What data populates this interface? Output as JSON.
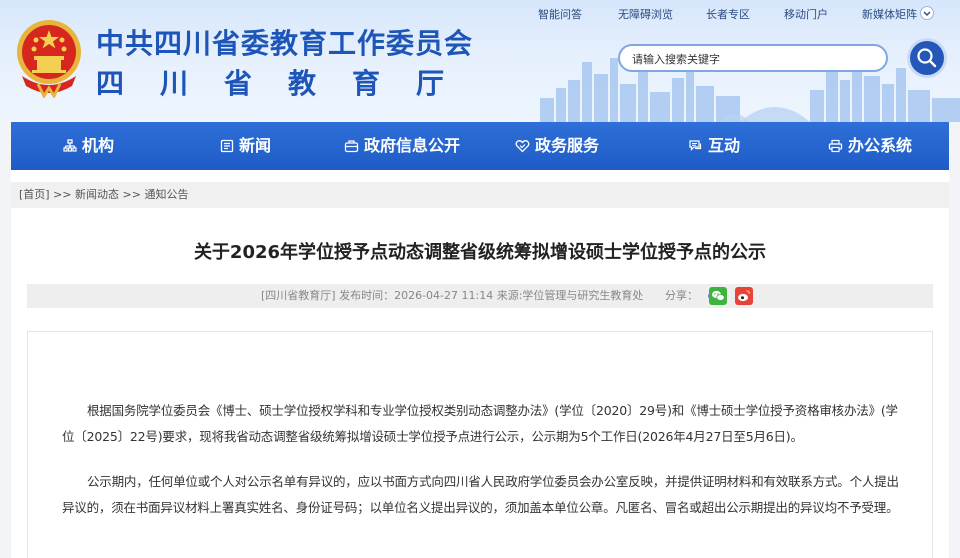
{
  "header": {
    "title_cn": "中共四川省委教育工作委员会",
    "title_dept": "四川省教育厅",
    "top_links": [
      "智能问答",
      "无障碍浏览",
      "长者专区",
      "移动门户",
      "新媒体矩阵"
    ],
    "search_placeholder": "请输入搜索关键字"
  },
  "nav": {
    "items": [
      "机构",
      "新闻",
      "政府信息公开",
      "政务服务",
      "互动",
      "办公系统"
    ]
  },
  "breadcrumb": {
    "home": "[首页]",
    "sep1": " >> ",
    "section": "新闻动态",
    "sep2": " >> ",
    "current": "通知公告"
  },
  "article": {
    "title": "关于2026年学位授予点动态调整省级统筹拟增设硕士学位授予点的公示",
    "meta": "[四川省教育厅]   发布时间：2026-04-27 11:14   来源:学位管理与研究生教育处",
    "share_label": "分享：",
    "paragraphs": [
      "根据国务院学位委员会《博士、硕士学位授权学科和专业学位授权类别动态调整办法》(学位〔2020〕29号)和《博士硕士学位授予资格审核办法》(学位〔2025〕22号)要求，现将我省动态调整省级统筹拟增设硕士学位授予点进行公示，公示期为5个工作日(2026年4月27日至5月6日)。",
      "公示期内，任何单位或个人对公示名单有异议的，应以书面方式向四川省人民政府学位委员会办公室反映，并提供证明材料和有效联系方式。个人提出异议的，须在书面异议材料上署真实姓名、身份证号码；以单位名义提出异议的，须加盖本单位公章。凡匿名、冒名或超出公示期提出的异议均不予受理。"
    ]
  },
  "colors": {
    "brand_blue": "#1d55b8",
    "nav_blue": "#1f5bc6",
    "wechat_green": "#3fb33f",
    "weibo_red": "#e6433a"
  }
}
